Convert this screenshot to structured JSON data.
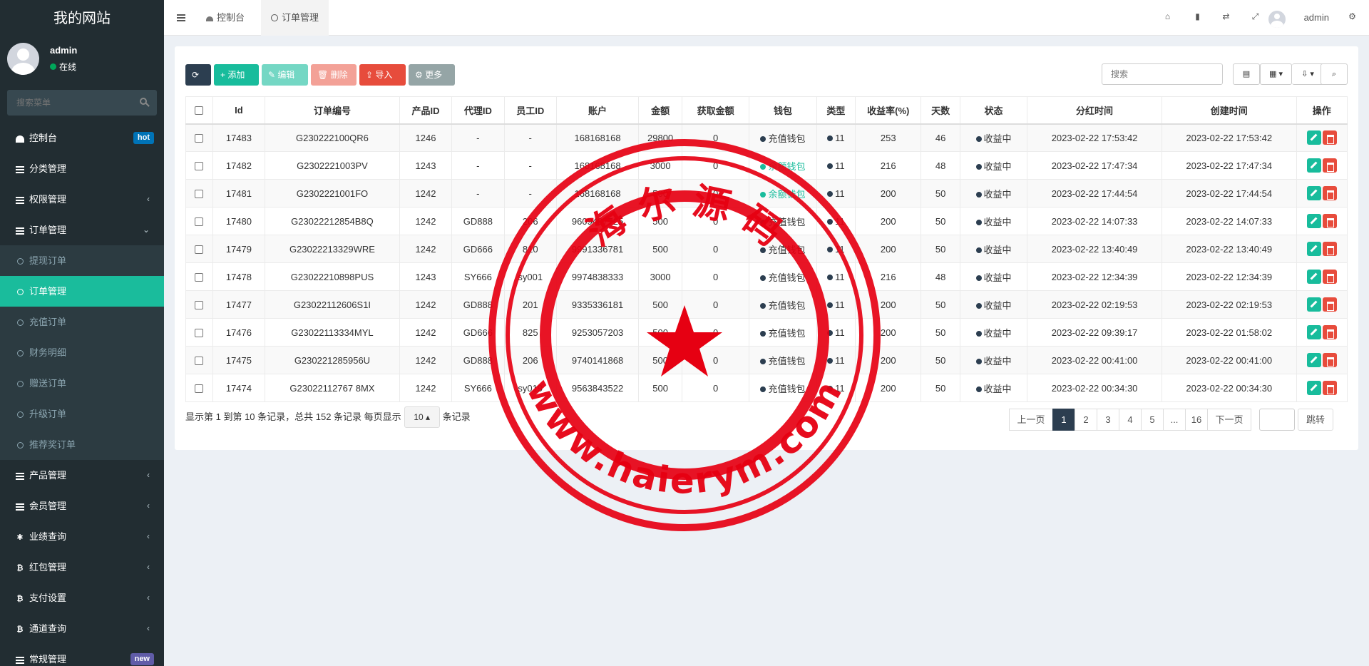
{
  "sidebar": {
    "logo": "我的网站",
    "user": {
      "name": "admin",
      "status": "在线"
    },
    "search_placeholder": "搜索菜单",
    "menu": [
      {
        "label": "控制台",
        "badge": "hot",
        "icon": "dashboard-icon"
      },
      {
        "label": "分类管理",
        "icon": "list-icon"
      },
      {
        "label": "权限管理",
        "icon": "list-icon",
        "chevron": "‹"
      },
      {
        "label": "订单管理",
        "icon": "list-icon",
        "chevron": "⌄",
        "open": true
      },
      {
        "label": "提现订单",
        "sub": true
      },
      {
        "label": "订单管理",
        "sub": true,
        "active": true
      },
      {
        "label": "充值订单",
        "sub": true
      },
      {
        "label": "财务明细",
        "sub": true
      },
      {
        "label": "赠送订单",
        "sub": true
      },
      {
        "label": "升级订单",
        "sub": true
      },
      {
        "label": "推荐奖订单",
        "sub": true
      },
      {
        "label": "产品管理",
        "icon": "list-icon",
        "chevron": "‹"
      },
      {
        "label": "会员管理",
        "icon": "list-icon",
        "chevron": "‹"
      },
      {
        "label": "业绩查询",
        "icon": "asterisk-icon",
        "chevron": "‹"
      },
      {
        "label": "红包管理",
        "icon": "bitcoin-icon",
        "chevron": "‹"
      },
      {
        "label": "支付设置",
        "icon": "bitcoin-icon",
        "chevron": "‹"
      },
      {
        "label": "通道查询",
        "icon": "bitcoin-icon",
        "chevron": "‹"
      },
      {
        "label": "常规管理",
        "icon": "list-icon",
        "badge": "new"
      }
    ]
  },
  "header": {
    "tabs": [
      {
        "label": "控制台",
        "icon": "dashboard-icon"
      },
      {
        "label": "订单管理",
        "icon": "circle-icon",
        "active": true
      }
    ],
    "user": "admin"
  },
  "toolbar": {
    "add": "+ 添加",
    "edit": "✎ 编辑",
    "delete": "🗑 删除",
    "import": "⇪ 导入",
    "more": "⚙ 更多",
    "search_placeholder": "搜索"
  },
  "table": {
    "columns": [
      "Id",
      "订单编号",
      "产品ID",
      "代理ID",
      "员工ID",
      "账户",
      "金额",
      "获取金额",
      "钱包",
      "类型",
      "收益率(%)",
      "天数",
      "状态",
      "分红时间",
      "创建时间",
      "操作"
    ],
    "rows": [
      [
        "17483",
        "G230222100QR6",
        "1246",
        "-",
        "-",
        "168168168",
        "29800",
        "0",
        "充值钱包",
        "11",
        "253",
        "46",
        "收益中",
        "2023-02-22 17:53:42",
        "2023-02-22 17:53:42"
      ],
      [
        "17482",
        "G2302221003PV",
        "1243",
        "-",
        "-",
        "168168168",
        "3000",
        "0",
        "余额钱包",
        "11",
        "216",
        "48",
        "收益中",
        "2023-02-22 17:47:34",
        "2023-02-22 17:47:34"
      ],
      [
        "17481",
        "G2302221001FO",
        "1242",
        "-",
        "-",
        "168168168",
        "500",
        "0",
        "余额钱包",
        "11",
        "200",
        "50",
        "收益中",
        "2023-02-22 17:44:54",
        "2023-02-22 17:44:54"
      ],
      [
        "17480",
        "G23022212854B8Q",
        "1242",
        "GD888",
        "206",
        "9609407725",
        "500",
        "0",
        "充值钱包",
        "11",
        "200",
        "50",
        "收益中",
        "2023-02-22 14:07:33",
        "2023-02-22 14:07:33"
      ],
      [
        "17479",
        "G23022213329WRE",
        "1242",
        "GD666",
        "810",
        "9991336781",
        "500",
        "0",
        "充值钱包",
        "11",
        "200",
        "50",
        "收益中",
        "2023-02-22 13:40:49",
        "2023-02-22 13:40:49"
      ],
      [
        "17478",
        "G23022210898PUS",
        "1243",
        "SY666",
        "sy001",
        "9974838333",
        "3000",
        "0",
        "充值钱包",
        "11",
        "216",
        "48",
        "收益中",
        "2023-02-22 12:34:39",
        "2023-02-22 12:34:39"
      ],
      [
        "17477",
        "G23022112606S1I",
        "1242",
        "GD888",
        "201",
        "9335336181",
        "500",
        "0",
        "充值钱包",
        "11",
        "200",
        "50",
        "收益中",
        "2023-02-22 02:19:53",
        "2023-02-22 02:19:53"
      ],
      [
        "17476",
        "G23022113334MYL",
        "1242",
        "GD666",
        "825",
        "9253057203",
        "500",
        "0",
        "充值钱包",
        "11",
        "200",
        "50",
        "收益中",
        "2023-02-22 09:39:17",
        "2023-02-22 01:58:02"
      ],
      [
        "17475",
        "G230221285956U",
        "1242",
        "GD888",
        "206",
        "9740141868",
        "500",
        "0",
        "充值钱包",
        "11",
        "200",
        "50",
        "收益中",
        "2023-02-22 00:41:00",
        "2023-02-22 00:41:00"
      ],
      [
        "17474",
        "G23022112767 8MX",
        "1242",
        "SY666",
        "sy019",
        "9563843522",
        "500",
        "0",
        "充值钱包",
        "11",
        "200",
        "50",
        "收益中",
        "2023-02-22 00:34:30",
        "2023-02-22 00:34:30"
      ]
    ]
  },
  "pagination": {
    "info_prefix": "显示第 1 到第 10 条记录，总共 152 条记录 每页显示",
    "page_size": "10",
    "info_suffix": "条记录",
    "prev": "上一页",
    "pages": [
      "1",
      "2",
      "3",
      "4",
      "5",
      "...",
      "16"
    ],
    "next": "下一页",
    "jump": "跳转"
  },
  "stamp": {
    "top_text": "海 尔 源 码",
    "bottom_text": "www.haierym.com",
    "color": "#e60012"
  }
}
